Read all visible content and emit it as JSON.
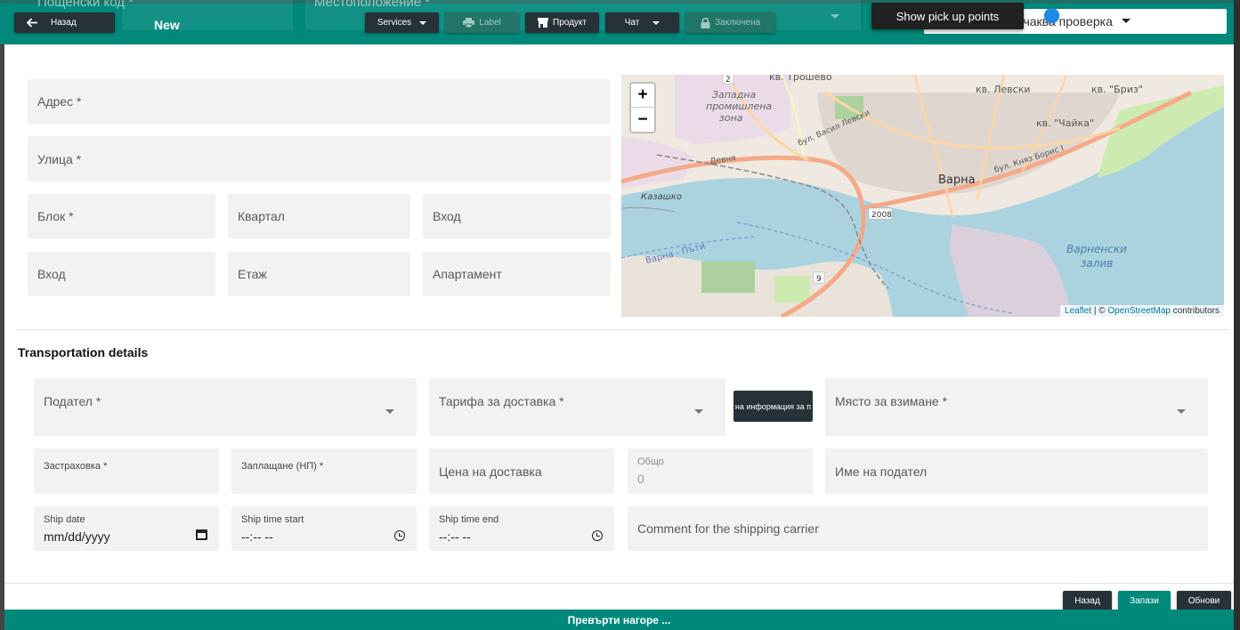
{
  "topbar": {
    "ghost_postal": "Пощенски код *",
    "ghost_location": "Местоположение *",
    "back_label": "Назад",
    "title": "New",
    "services_label": "Services",
    "label_label": "Label",
    "product_label": "Продукт",
    "chat_label": "Чат",
    "locked_label": "Заключена",
    "pickup_points_label": "Show pick up points",
    "check_select_value": "очаква проверка"
  },
  "address": {
    "address_ph": "Адрес *",
    "street_ph": "Улица *",
    "block_ph": "Блок *",
    "quarter_ph": "Квартал",
    "entrance_ph": "Вход",
    "entrance2_ph": "Вход",
    "floor_ph": "Етаж",
    "apartment_ph": "Апартамент"
  },
  "map": {
    "zoom_in": "+",
    "zoom_out": "−",
    "attribution_leaflet": "Leaflet",
    "attribution_sep": " | © ",
    "attribution_osm": "OpenStreetMap",
    "attribution_tail": " contributors",
    "labels": {
      "trosheve": "кв. Трошево",
      "levski": "кв. Левски",
      "briz": "кв. \"Бриз\"",
      "chaika": "кв. \"Чайка\"",
      "zone1": "Западна",
      "zone2": "промишлена",
      "zone3": "зона",
      "city": "Варна",
      "bay1": "Варненски",
      "bay2": "залив",
      "kazashko": "Казашко",
      "varna_poti": "Варна - Пъти",
      "road_2008": "2008",
      "road_9": "9",
      "road_2": "2",
      "blvd_vasil": "бул. Васил Левски",
      "blvd_knyaz": "бул. Княз Борис I",
      "devnya": "Девня"
    }
  },
  "transport": {
    "section_title": "Transportation details",
    "sender_ph": "Подател *",
    "tariff_ph": "Тарифа за доставка *",
    "tooltip": "Показване на информация за п",
    "pickup_place_ph": "Място за взимане *",
    "insurance_label": "Застраховка *",
    "payment_label": "Заплащане (НП) *",
    "delivery_price_ph": "Цена на доставка",
    "total_label": "Общо",
    "total_value": "0",
    "sender_name_ph": "Име на подател",
    "ship_date_label": "Ship date",
    "ship_date_value": "mm/dd/yyyy",
    "ship_time_start_label": "Ship time start",
    "ship_time_start_value": "--:-- --",
    "ship_time_end_label": "Ship time end",
    "ship_time_end_value": "--:-- --",
    "comment_ph": "Comment for the shipping carrier"
  },
  "actions": {
    "back_label": "Назад",
    "save_label": "Запази",
    "update_label": "Обнови"
  },
  "footer": {
    "scroll_top_label": "Превърти нагоре ..."
  },
  "colors": {
    "brand_teal": "#00897b",
    "dark_button": "#263238",
    "field_bg": "#f2f2f2"
  }
}
